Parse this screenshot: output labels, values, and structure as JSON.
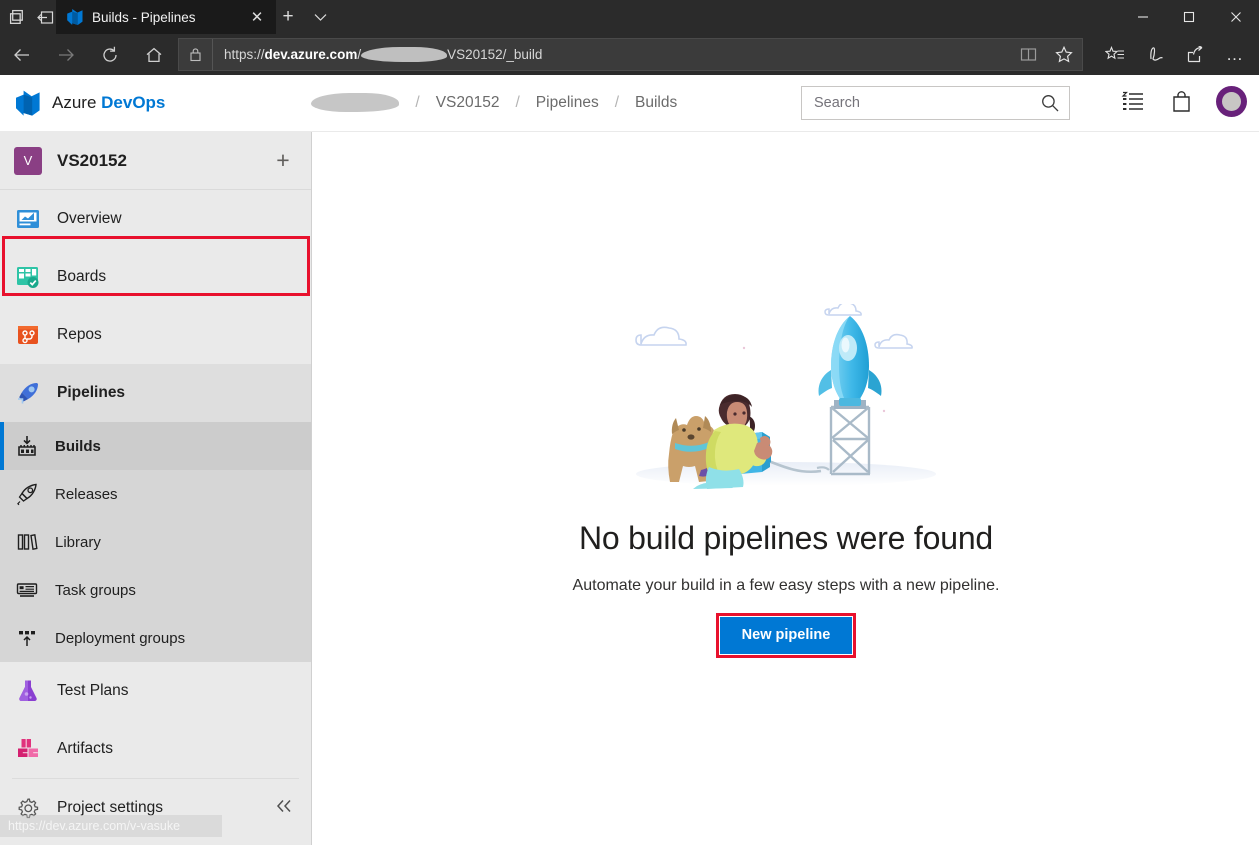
{
  "browser": {
    "tab": {
      "title": "Builds - Pipelines",
      "favicon": "azure-devops-favicon",
      "close": "✕"
    },
    "new_tab_label": "+",
    "tab_list_label": "⌄",
    "window_controls": {
      "minimize": "—",
      "maximize": "☐",
      "close": "✕"
    },
    "nav": {
      "back": "←",
      "forward": "→",
      "refresh": "↻",
      "home": "⌂"
    },
    "url": {
      "prefix": "https://",
      "domain": "dev.azure.com",
      "redacted_segment": "/",
      "suffix": "VS20152/_build",
      "lock_icon": "lock-icon"
    },
    "url_icons": {
      "reading_view": "reading-view-icon",
      "favorite": "star-icon"
    },
    "toolbar_icons": {
      "favorites": "favorites-star-list-icon",
      "web_notes": "pen-icon",
      "share": "share-icon",
      "settings": "…"
    }
  },
  "header": {
    "brand_prefix": "Azure ",
    "brand_suffix": "DevOps",
    "logo": "azure-devops-logo",
    "breadcrumb": [
      {
        "label": "",
        "redacted": true
      },
      {
        "label": "VS20152",
        "redacted": false
      },
      {
        "label": "Pipelines",
        "redacted": false
      },
      {
        "label": "Builds",
        "redacted": false
      }
    ],
    "breadcrumb_separator": "/",
    "search": {
      "placeholder": "Search",
      "value": "",
      "icon": "search-icon"
    },
    "icons": {
      "backlog": "backlog-list-icon",
      "marketplace": "shopping-bag-icon",
      "avatar": "user-avatar"
    },
    "accent_color": "#0078d4"
  },
  "sidebar": {
    "project": {
      "initial": "V",
      "name": "VS20152",
      "add_label": "+"
    },
    "items": [
      {
        "label": "Overview",
        "icon": "overview-icon",
        "level": "top",
        "state": "normal"
      },
      {
        "label": "Boards",
        "icon": "boards-icon",
        "level": "top",
        "state": "normal"
      },
      {
        "label": "Repos",
        "icon": "repos-icon",
        "level": "top",
        "state": "normal"
      },
      {
        "label": "Pipelines",
        "icon": "pipelines-icon",
        "level": "top",
        "state": "highlighted"
      },
      {
        "label": "Builds",
        "icon": "builds-icon",
        "level": "sub",
        "state": "selected"
      },
      {
        "label": "Releases",
        "icon": "releases-rocket-icon",
        "level": "sub",
        "state": "normal"
      },
      {
        "label": "Library",
        "icon": "library-icon",
        "level": "sub",
        "state": "normal"
      },
      {
        "label": "Task groups",
        "icon": "task-groups-icon",
        "level": "sub",
        "state": "normal"
      },
      {
        "label": "Deployment groups",
        "icon": "deployment-groups-icon",
        "level": "sub",
        "state": "normal"
      },
      {
        "label": "Test Plans",
        "icon": "test-plans-flask-icon",
        "level": "top",
        "state": "normal"
      },
      {
        "label": "Artifacts",
        "icon": "artifacts-icon",
        "level": "top",
        "state": "normal"
      }
    ],
    "settings": {
      "label": "Project settings",
      "icon": "gear-icon",
      "collapse_icon": "chevron-double-left-icon"
    },
    "status_link": "https://dev.azure.com/v-vasuke",
    "highlight_color": "#e8112d",
    "selected_accent": "#0078d4"
  },
  "main": {
    "illustration": "rocket-launch-illustration",
    "title": "No build pipelines were found",
    "subtitle": "Automate your build in a few easy steps with a new pipeline.",
    "primary_button": "New pipeline",
    "button_color": "#0078d4",
    "button_highlight_color": "#e8112d"
  }
}
